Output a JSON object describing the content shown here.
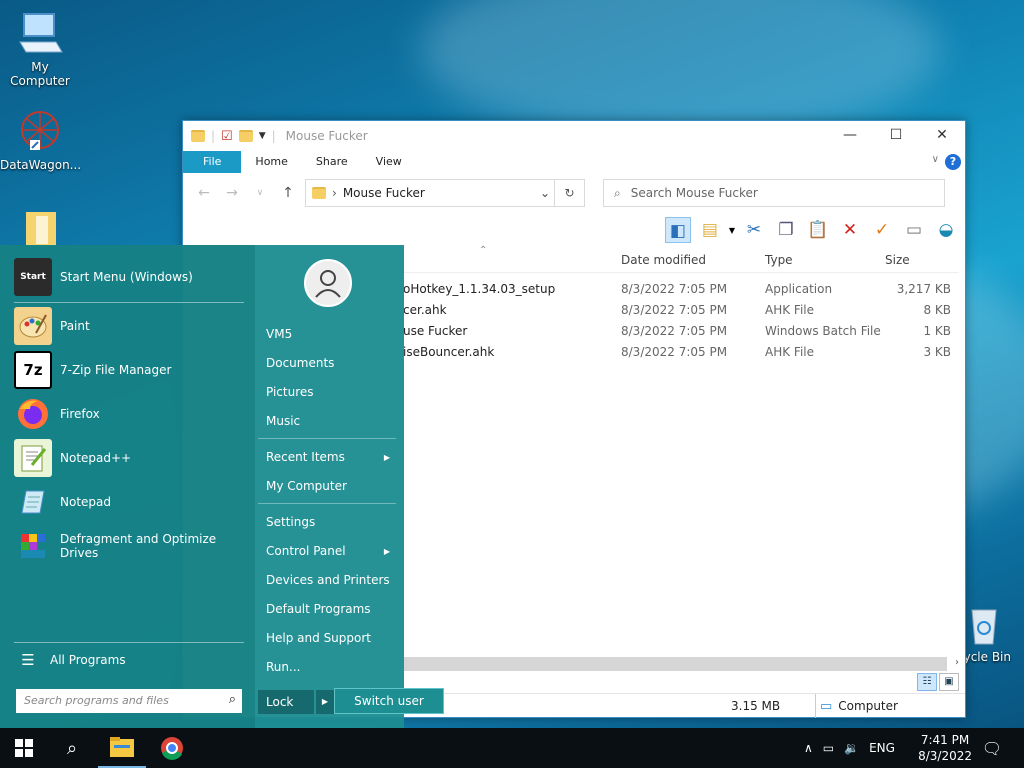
{
  "desktop": {
    "icons": [
      {
        "label": "My Computer"
      },
      {
        "label": "DataWagon..."
      },
      {
        "label": "cycle Bin"
      }
    ]
  },
  "explorer": {
    "title": "Mouse Fucker",
    "tabs": [
      {
        "label": "File"
      },
      {
        "label": "Home"
      },
      {
        "label": "Share"
      },
      {
        "label": "View"
      }
    ],
    "address": "Mouse Fucker",
    "search_placeholder": "Search Mouse Fucker",
    "columns": {
      "name": "",
      "date": "Date modified",
      "type": "Type",
      "size": "Size"
    },
    "files": [
      {
        "name": "oHotkey_1.1.34.03_setup",
        "date": "8/3/2022 7:05 PM",
        "type": "Application",
        "size": "3,217 KB"
      },
      {
        "name": "cer.ahk",
        "date": "8/3/2022 7:05 PM",
        "type": "AHK File",
        "size": "8 KB"
      },
      {
        "name": "use Fucker",
        "date": "8/3/2022 7:05 PM",
        "type": "Windows Batch File",
        "size": "1 KB"
      },
      {
        "name": "iseBouncer.ahk",
        "date": "8/3/2022 7:05 PM",
        "type": "AHK File",
        "size": "3 KB"
      }
    ],
    "status": {
      "size": "3.15 MB",
      "location": "Computer"
    }
  },
  "startmenu": {
    "programs": [
      {
        "label": "Start Menu (Windows)"
      },
      {
        "label": "Paint"
      },
      {
        "label": "7-Zip File Manager"
      },
      {
        "label": "Firefox"
      },
      {
        "label": "Notepad++"
      },
      {
        "label": "Notepad"
      },
      {
        "label": "Defragment and Optimize Drives"
      }
    ],
    "all_programs": "All Programs",
    "search_placeholder": "Search programs and files",
    "right_items": [
      {
        "label": "VM5"
      },
      {
        "label": "Documents"
      },
      {
        "label": "Pictures"
      },
      {
        "label": "Music"
      },
      {
        "label": "Recent Items"
      },
      {
        "label": "My Computer"
      },
      {
        "label": "Settings"
      },
      {
        "label": "Control Panel"
      },
      {
        "label": "Devices and Printers"
      },
      {
        "label": "Default Programs"
      },
      {
        "label": "Help and Support"
      },
      {
        "label": "Run..."
      }
    ],
    "lock_label": "Lock",
    "switch_user_label": "Switch user",
    "start_tile_text": "Start"
  },
  "taskbar": {
    "language": "ENG",
    "time": "7:41 PM",
    "date": "8/3/2022"
  },
  "colors": {
    "start_menu": "#1d8e92",
    "ribbon_file": "#1b9ac6",
    "taskbar": "#0a0f14"
  }
}
